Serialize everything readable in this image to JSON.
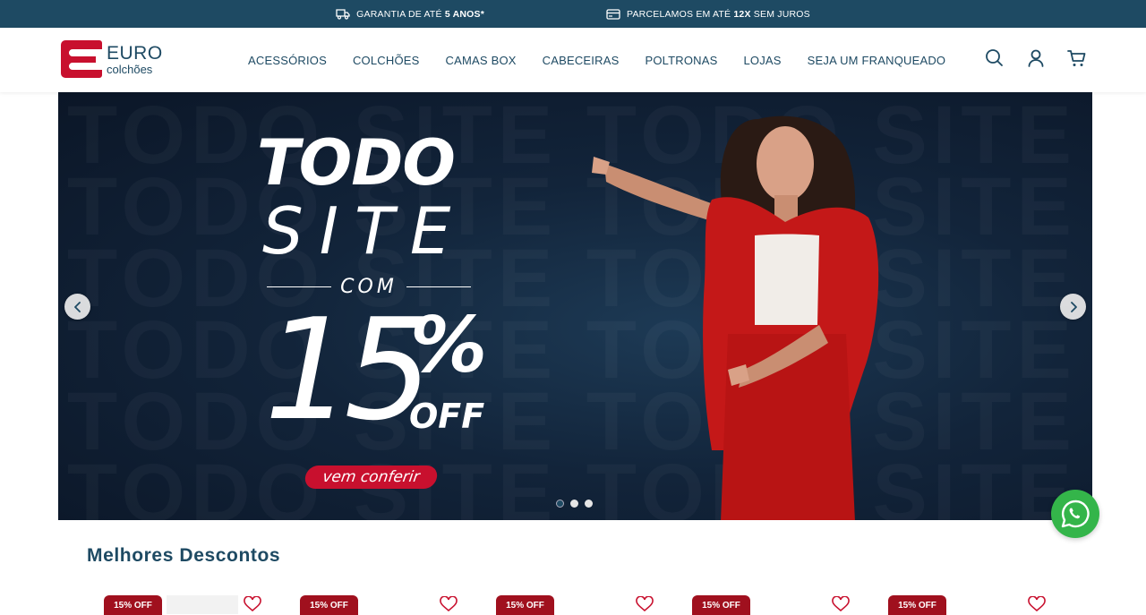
{
  "topbar": {
    "warranty_prefix": "GARANTIA DE ATÉ ",
    "warranty_bold": "5 ANOS*",
    "installments_prefix": "PARCELAMOS EM ATÉ ",
    "installments_bold": "12X",
    "installments_suffix": " SEM JUROS"
  },
  "brand": {
    "name": "EURO",
    "sub": "colchões",
    "color": "#c8102e"
  },
  "nav": {
    "items": [
      {
        "label": "ACESSÓRIOS"
      },
      {
        "label": "COLCHÕES"
      },
      {
        "label": "CAMAS BOX"
      },
      {
        "label": "CABECEIRAS"
      },
      {
        "label": "POLTRONAS"
      },
      {
        "label": "LOJAS"
      },
      {
        "label": "SEJA UM FRANQUEADO"
      }
    ]
  },
  "header_icons": [
    "search-icon",
    "user-icon",
    "cart-icon"
  ],
  "hero": {
    "line1": "TODO",
    "line2": "SITE",
    "line3": "COM",
    "discount_number": "15",
    "discount_symbol": "%",
    "discount_suffix": "OFF",
    "cta": "vem conferir",
    "slides_total": 3,
    "slide_active": 1
  },
  "section": {
    "title": "Melhores Descontos"
  },
  "products": [
    {
      "badge": "15% OFF"
    },
    {
      "badge": "15% OFF"
    },
    {
      "badge": "15% OFF"
    },
    {
      "badge": "15% OFF"
    },
    {
      "badge": "15% OFF"
    }
  ],
  "colors": {
    "primary": "#1e4a63",
    "accent": "#c8102e",
    "whatsapp": "#34b54a"
  }
}
